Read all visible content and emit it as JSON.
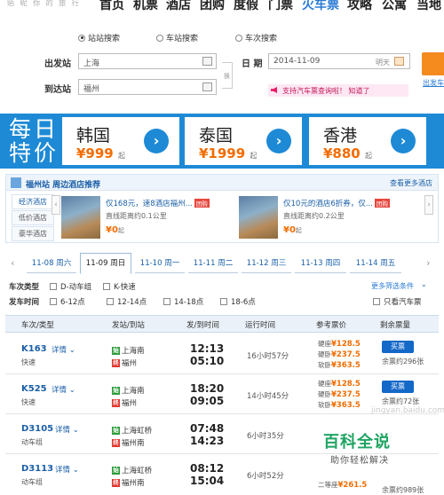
{
  "nav": {
    "slogan": "贴 昵 你 的 旅 行",
    "items": [
      "首页",
      "机票",
      "酒店",
      "团购",
      "度假",
      "门票",
      "火车票",
      "攻略",
      "公寓",
      "当地人"
    ],
    "active_index": 6
  },
  "search": {
    "modes": [
      "站站搜索",
      "车站搜索",
      "车次搜索"
    ],
    "selected_mode": 0,
    "from_label": "出发站",
    "from_value": "上海",
    "to_label": "到达站",
    "to_value": "福州",
    "swap_label": "换",
    "date_label": "日 期",
    "date_value": "2014-11-09",
    "date_hint": "明天",
    "notice": "支持汽车票查询啦！ 知道了",
    "side_link": "出发车"
  },
  "deals": {
    "label_line1": "每日",
    "label_line2": "特价",
    "cards": [
      {
        "city": "韩国",
        "price": "¥999",
        "suffix": "起"
      },
      {
        "city": "泰国",
        "price": "¥1999",
        "suffix": "起"
      },
      {
        "city": "香港",
        "price": "¥880",
        "suffix": "起"
      }
    ]
  },
  "hotels": {
    "title": "福州站  周边酒店推荐",
    "more": "查看更多酒店",
    "tabs": [
      "经济酒店",
      "低价酒店",
      "豪华酒店"
    ],
    "active_tab": 0,
    "items": [
      {
        "name": "仅168元，速8酒店福州...",
        "tag": "团购",
        "distance": "直线距离约0.1公里",
        "price": "¥0",
        "suffix": "起"
      },
      {
        "name": "仅10元的酒店6折券，仅...",
        "tag": "团购",
        "distance": "直线距离约0.2公里",
        "price": "¥0",
        "suffix": "起"
      }
    ]
  },
  "dates": {
    "prev": "‹",
    "next": "›",
    "tabs": [
      "11-08 周六",
      "11-09 周日",
      "11-10 周一",
      "11-11 周二",
      "11-12 周三",
      "11-13 周四",
      "11-14 周五"
    ],
    "active_index": 1
  },
  "filters": {
    "type_label": "车次类型",
    "types": [
      "D-动车组",
      "K-快速"
    ],
    "more_link": "更多筛选条件",
    "time_label": "发车时间",
    "times": [
      "6-12点",
      "12-14点",
      "14-18点",
      "18-6点"
    ],
    "bus_option": "只看汽车票"
  },
  "table": {
    "headers": [
      "车次/类型",
      "发站/到站",
      "发/到时间",
      "运行时间",
      "参考票价",
      "剩余票量"
    ],
    "detail_label": "详情",
    "buy_label": "买票",
    "start_mark": "始",
    "end_mark": "终",
    "rows": [
      {
        "train": "K163",
        "type": "快速",
        "from": "上海南",
        "to": "福州",
        "dep": "12:13",
        "arr": "05:10",
        "duration": "16小时57分",
        "prices": [
          {
            "seat": "硬座",
            "price": "¥128.5"
          },
          {
            "seat": "硬卧",
            "price": "¥237.5"
          },
          {
            "seat": "软卧",
            "price": "¥363.5"
          }
        ],
        "left": "余票约296张"
      },
      {
        "train": "K525",
        "type": "快速",
        "from": "上海南",
        "to": "福州",
        "dep": "18:20",
        "arr": "09:05",
        "duration": "14小时45分",
        "prices": [
          {
            "seat": "硬座",
            "price": "¥128.5"
          },
          {
            "seat": "硬卧",
            "price": "¥237.5"
          },
          {
            "seat": "软卧",
            "price": "¥363.5"
          }
        ],
        "left": "余票约72张"
      },
      {
        "train": "D3105",
        "type": "动车组",
        "from": "上海虹桥",
        "to": "福州南",
        "dep": "07:48",
        "arr": "14:23",
        "duration": "6小时35分",
        "prices": [],
        "left": ""
      },
      {
        "train": "D3113",
        "type": "动车组",
        "from": "上海虹桥",
        "to": "福州南",
        "dep": "08:12",
        "arr": "15:04",
        "duration": "6小时52分",
        "prices": [
          {
            "seat": "二等座",
            "price": "¥261.5"
          }
        ],
        "left": "余票约989张"
      }
    ]
  },
  "watermark": {
    "site": "jingyan.baidu.com",
    "big": "百科全说",
    "small": "助你轻松解决"
  }
}
